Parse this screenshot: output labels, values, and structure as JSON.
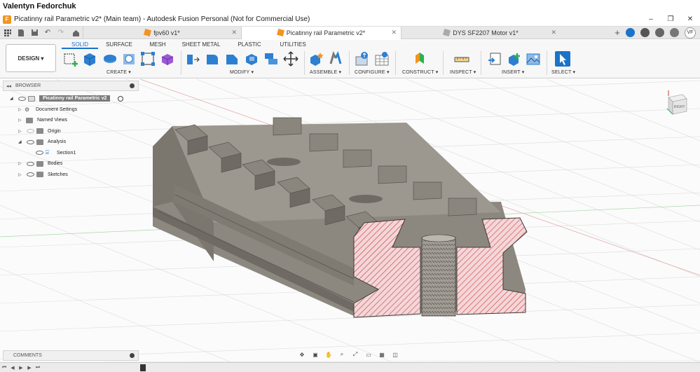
{
  "post_author": "Valentyn Fedorchuk",
  "window": {
    "title": "Picatinny rail Parametric v2* (Main team) - Autodesk Fusion Personal (Not for Commercial Use)",
    "controls": [
      "–",
      "❐",
      "✕"
    ]
  },
  "tabs": [
    {
      "label": "fpv60 v1*",
      "active": false
    },
    {
      "label": "Picatinny rail Parametric v2*",
      "active": true
    },
    {
      "label": "DYS SF2207 Motor v1*",
      "active": false
    }
  ],
  "user": {
    "initials": "VF"
  },
  "ribbon": {
    "workspace": "DESIGN ▾",
    "tabs": [
      "SOLID",
      "SURFACE",
      "MESH",
      "SHEET METAL",
      "PLASTIC",
      "UTILITIES"
    ],
    "active_tab": "SOLID",
    "groups": [
      "CREATE ▾",
      "MODIFY ▾",
      "ASSEMBLE ▾",
      "CONFIGURE ▾",
      "CONSTRUCT ▾",
      "INSPECT ▾",
      "INSERT ▾",
      "SELECT ▾"
    ]
  },
  "browser": {
    "header": "BROWSER",
    "root": "Picatinny rail Parametric v2",
    "items": [
      {
        "label": "Document Settings",
        "icon": "gear-icon"
      },
      {
        "label": "Named Views",
        "icon": "folder-icon"
      },
      {
        "label": "Origin",
        "icon": "folder-icon"
      },
      {
        "label": "Analysis",
        "icon": "folder-icon"
      },
      {
        "label": "Section1",
        "icon": "section-analysis-icon"
      },
      {
        "label": "Bodies",
        "icon": "folder-icon"
      },
      {
        "label": "Sketches",
        "icon": "folder-icon"
      }
    ]
  },
  "viewcube": {
    "face": "RIGHT"
  },
  "comments": {
    "header": "COMMENTS"
  },
  "colors": {
    "accent": "#1a73c8",
    "body_metal": "#8e8a83",
    "section_fill": "#f4d6d8",
    "section_hatch": "#c43c3c"
  }
}
